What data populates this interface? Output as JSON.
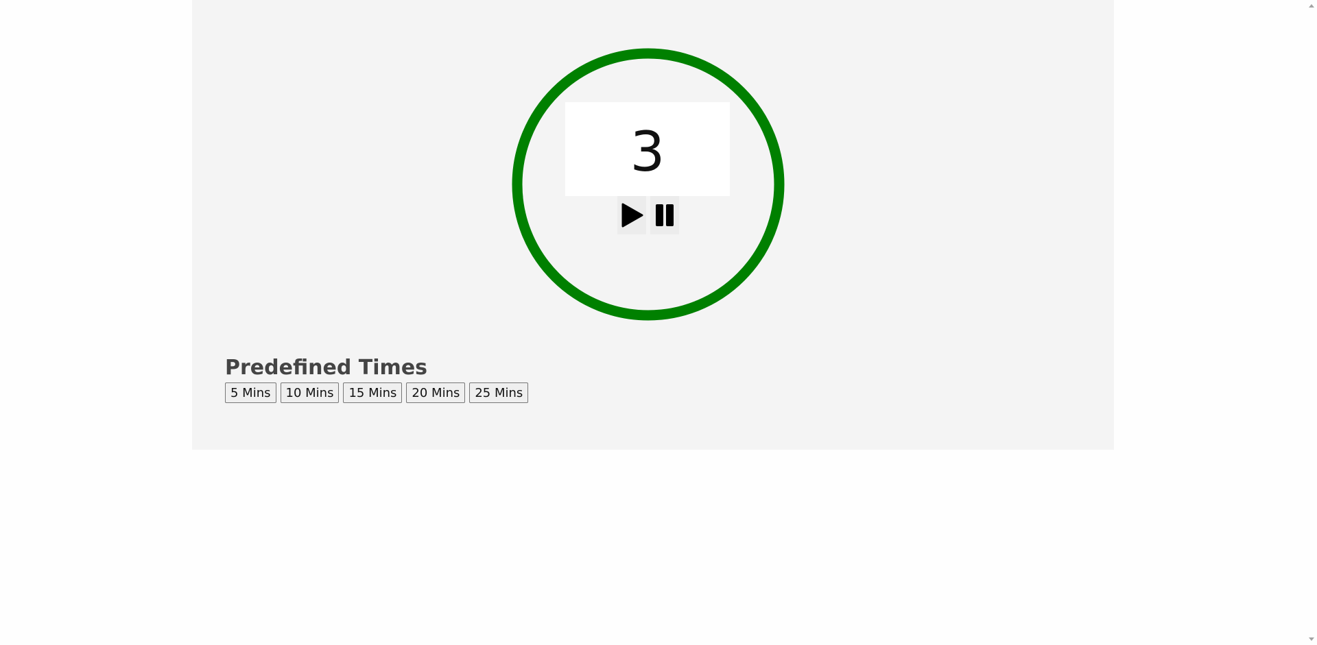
{
  "timer": {
    "value": "3",
    "ring_color": "#008000"
  },
  "controls": {
    "play_icon": "play-icon",
    "pause_icon": "pause-icon"
  },
  "predefined": {
    "heading": "Predefined Times",
    "buttons": [
      "5 Mins",
      "10 Mins",
      "15 Mins",
      "20 Mins",
      "25 Mins"
    ]
  }
}
